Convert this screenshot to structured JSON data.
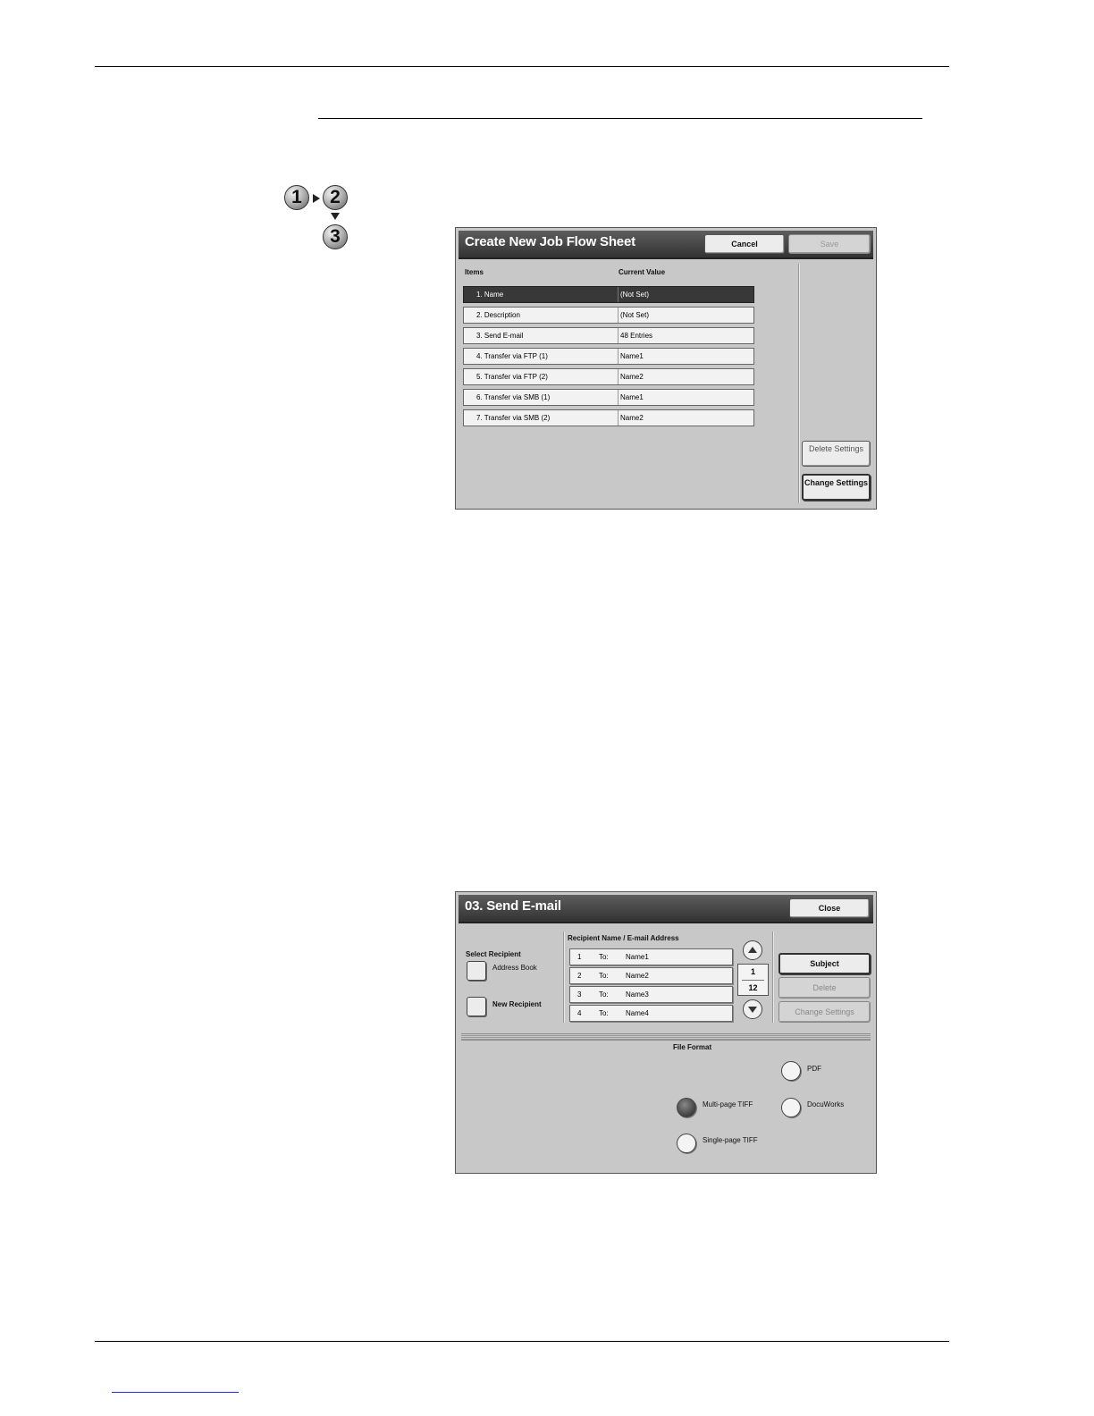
{
  "step_icon": {
    "n1": "1",
    "n2": "2",
    "n3": "3"
  },
  "create_dialog": {
    "title": "Create New Job Flow Sheet",
    "cancel_label": "Cancel",
    "save_label": "Save",
    "col_items": "Items",
    "col_value": "Current Value",
    "rows": [
      {
        "item": "1. Name",
        "value": "(Not Set)"
      },
      {
        "item": "2. Description",
        "value": "(Not Set)"
      },
      {
        "item": "3. Send E-mail",
        "value": "48 Entries"
      },
      {
        "item": "4. Transfer via FTP (1)",
        "value": "Name1"
      },
      {
        "item": "5. Transfer via FTP (2)",
        "value": "Name2"
      },
      {
        "item": "6. Transfer via SMB (1)",
        "value": "Name1"
      },
      {
        "item": "7. Transfer via SMB (2)",
        "value": "Name2"
      }
    ],
    "delete_label": "Delete Settings",
    "change_label": "Change Settings"
  },
  "email_dialog": {
    "title": "03. Send E-mail",
    "close_label": "Close",
    "select_recipient_label": "Select Recipient",
    "address_book_label": "Address Book",
    "new_recipient_label": "New Recipient",
    "recipient_header": "Recipient Name / E-mail Address",
    "recipients": [
      {
        "num": "1",
        "type": "To:",
        "name": "Name1"
      },
      {
        "num": "2",
        "type": "To:",
        "name": "Name2"
      },
      {
        "num": "3",
        "type": "To:",
        "name": "Name3"
      },
      {
        "num": "4",
        "type": "To:",
        "name": "Name4"
      }
    ],
    "page_current": "1",
    "page_total": "12",
    "subject_label": "Subject",
    "delete_label": "Delete",
    "change_label": "Change Settings",
    "file_format_label": "File Format",
    "formats": {
      "pdf": "PDF",
      "docuworks": "DocuWorks",
      "multi_tiff": "Multi-page TIFF",
      "single_tiff": "Single-page TIFF"
    },
    "selected_format": "Multi-page TIFF"
  }
}
